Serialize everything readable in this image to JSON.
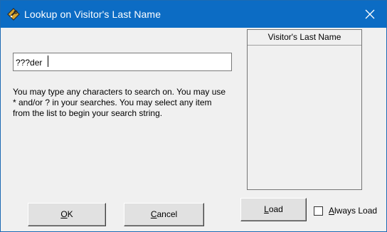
{
  "window": {
    "title": "Lookup on Visitor's Last Name",
    "title_icon": "wrench-gear-icon",
    "close_icon": "close-icon",
    "titlebar_color": "#0c6cc4"
  },
  "search": {
    "value": "???der"
  },
  "help_text": "You may type any characters to search on. You may use * and/or ? in your searches. You may select any item from the list to begin your search string.",
  "results_list": {
    "column_header": "Visitor's Last Name",
    "items": []
  },
  "buttons": {
    "ok": {
      "mnemonic": "O",
      "rest": "K"
    },
    "cancel": {
      "mnemonic": "C",
      "rest": "ancel"
    },
    "load": {
      "mnemonic": "L",
      "rest": "oad"
    }
  },
  "always_load": {
    "checked": false,
    "label_mnemonic": "A",
    "label_rest": "lways Load"
  }
}
